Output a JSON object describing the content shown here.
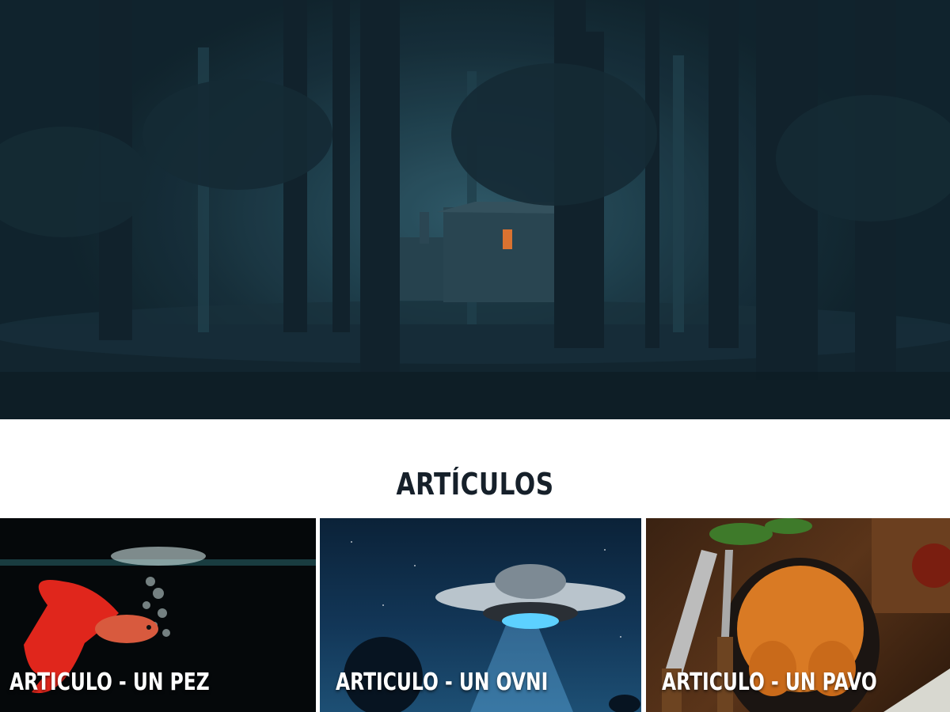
{
  "hero": {
    "image": "foggy-forest-house-at-night"
  },
  "articles_section": {
    "title": "ARTÍCULOS"
  },
  "articles": [
    {
      "label": "ARTICULO - UN PEZ",
      "image": "red-betta-fish"
    },
    {
      "label": "ARTICULO - UN OVNI",
      "image": "ufo-beam-night-sky"
    },
    {
      "label": "ARTICULO - UN PAVO",
      "image": "roast-turkey-carving-set"
    }
  ],
  "colors": {
    "title_text": "#16202a",
    "card_text": "#ffffff",
    "page_background": "#ffffff"
  }
}
